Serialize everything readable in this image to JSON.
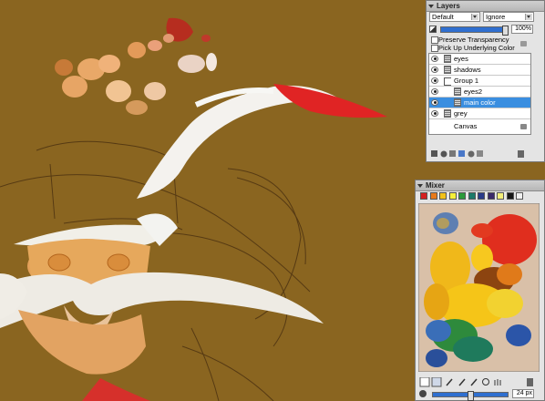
{
  "layers_panel": {
    "title": "Layers",
    "composite_method": "Default",
    "depth_method": "Ignore",
    "opacity_value": "100%",
    "preserve_transparency_label": "Preserve Transparency",
    "pick_up_color_label": "Pick Up Underlying Color",
    "layers": [
      {
        "name": "eyes",
        "type": "layer",
        "indent": 0,
        "selected": false
      },
      {
        "name": "shadows",
        "type": "layer",
        "indent": 0,
        "selected": false
      },
      {
        "name": "Group 1",
        "type": "group",
        "indent": 0,
        "selected": false
      },
      {
        "name": "eyes2",
        "type": "layer",
        "indent": 1,
        "selected": false
      },
      {
        "name": "main color",
        "type": "layer",
        "indent": 1,
        "selected": true
      },
      {
        "name": "grey",
        "type": "layer",
        "indent": 0,
        "selected": false
      },
      {
        "name": "Canvas",
        "type": "canvas",
        "indent": 0,
        "selected": false
      }
    ]
  },
  "mixer_panel": {
    "title": "Mixer",
    "swatches": [
      "#d42020",
      "#e87a1a",
      "#f2c21a",
      "#f5ef3a",
      "#2c9a3a",
      "#1c7a6a",
      "#2a3c8a",
      "#3a2a6a",
      "#f4ef7a",
      "#161616",
      "#f0f0f0"
    ],
    "brush_size": "24 px",
    "tools": [
      "dirty-brush-icon",
      "apply-color-icon",
      "mix-color-icon",
      "sample-color-icon",
      "sample-multiple-icon",
      "zoom-icon",
      "pan-icon",
      "clear-icon"
    ]
  },
  "colors": {
    "canvas_bg": "#8a6520",
    "selection": "#3a8ee0",
    "panel_bg": "#e4e4e4"
  }
}
